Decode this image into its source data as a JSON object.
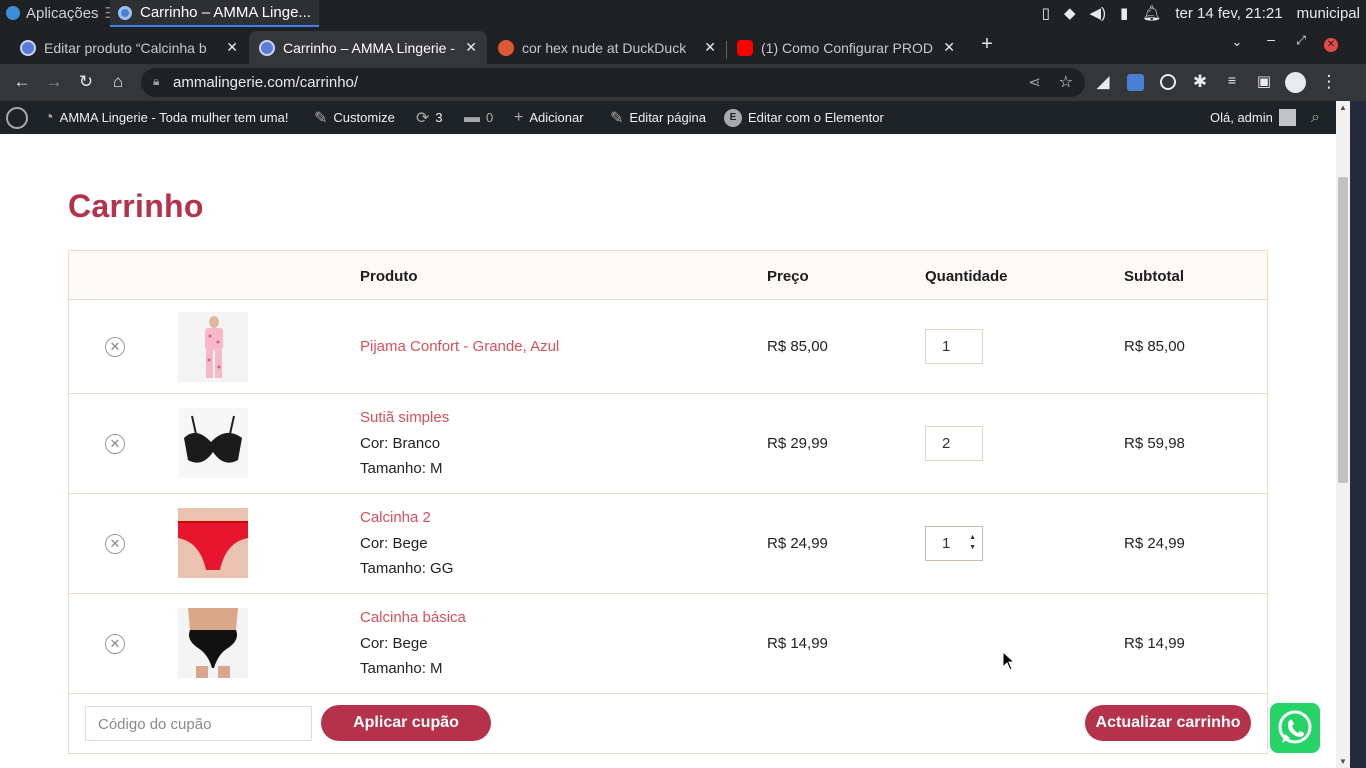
{
  "os": {
    "apps_label": "Aplicações",
    "window_title": "Carrinho – AMMA Linge...",
    "datetime": "ter 14 fev, 21:21",
    "user": "municipal"
  },
  "tabs": [
    {
      "title": "Editar produto “Calcinha b",
      "icon": "wordpress-icon"
    },
    {
      "title": "Carrinho – AMMA Lingerie -",
      "icon": "wordpress-icon",
      "active": true
    },
    {
      "title": "cor hex nude at DuckDuck",
      "icon": "duckduckgo-icon"
    },
    {
      "title": "(1) Como Configurar PROD",
      "icon": "youtube-icon"
    }
  ],
  "url": "ammalingerie.com/carrinho/",
  "wpbar": {
    "site": "AMMA Lingerie - Toda mulher tem uma!",
    "customize": "Customize",
    "updates": "3",
    "comments": "0",
    "add": "Adicionar",
    "edit_page": "Editar página",
    "elementor": "Editar com o Elementor",
    "greeting": "Olá, admin"
  },
  "page": {
    "title": "Carrinho",
    "headers": {
      "product": "Produto",
      "price": "Preço",
      "quantity": "Quantidade",
      "subtotal": "Subtotal"
    },
    "items": [
      {
        "name": "Pijama Confort - Grande, Azul",
        "attr1": "",
        "attr2": "",
        "price": "R$ 85,00",
        "qty": "1",
        "subtotal": "R$ 85,00"
      },
      {
        "name": "Sutiã simples",
        "attr1": "Cor: Branco",
        "attr2": "Tamanho: M",
        "price": "R$ 29,99",
        "qty": "2",
        "subtotal": "R$ 59,98"
      },
      {
        "name": "Calcinha 2",
        "attr1": "Cor: Bege",
        "attr2": "Tamanho: GG",
        "price": "R$ 24,99",
        "qty": "1",
        "subtotal": "R$ 24,99"
      },
      {
        "name": "Calcinha básica",
        "attr1": "Cor: Bege",
        "attr2": "Tamanho: M",
        "price": "R$ 14,99",
        "qty": "",
        "subtotal": "R$ 14,99"
      }
    ],
    "coupon_placeholder": "Código do cupão",
    "apply_coupon": "Aplicar cupão",
    "update_cart": "Actualizar carrinho"
  },
  "colors": {
    "accent": "#b5324a",
    "link": "#e04e59",
    "whatsapp": "#25d366"
  }
}
